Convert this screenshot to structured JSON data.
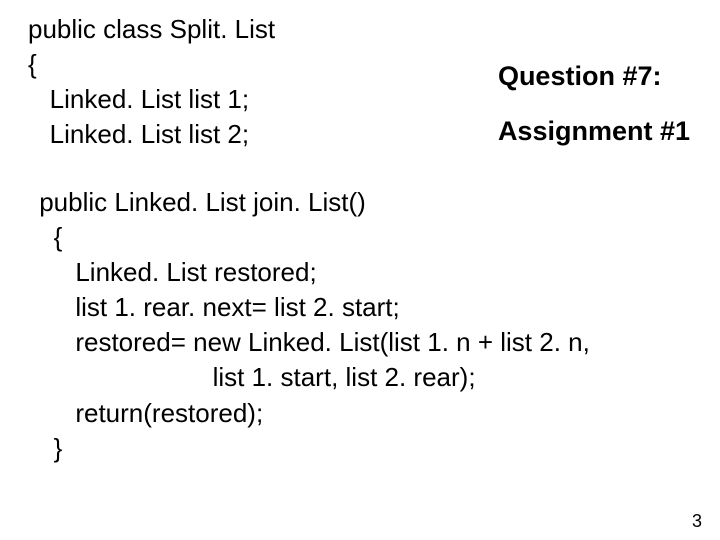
{
  "header": {
    "question": "Question #7:",
    "assignment": "Assignment #1"
  },
  "code": {
    "decl1": "public class Split. List",
    "decl2": "{",
    "decl3": "   Linked. List list 1;",
    "decl4": "   Linked. List list 2;",
    "m1": " public Linked. List join. List()",
    "m2": "   {",
    "m3": "      Linked. List restored;",
    "m4": "",
    "m5": "      list 1. rear. next= list 2. start;",
    "m6": "      restored= new Linked. List(list 1. n + list 2. n,",
    "m7": "                         list 1. start, list 2. rear);",
    "m8": "      return(restored);",
    "m9": "   }"
  },
  "page_number": "3"
}
